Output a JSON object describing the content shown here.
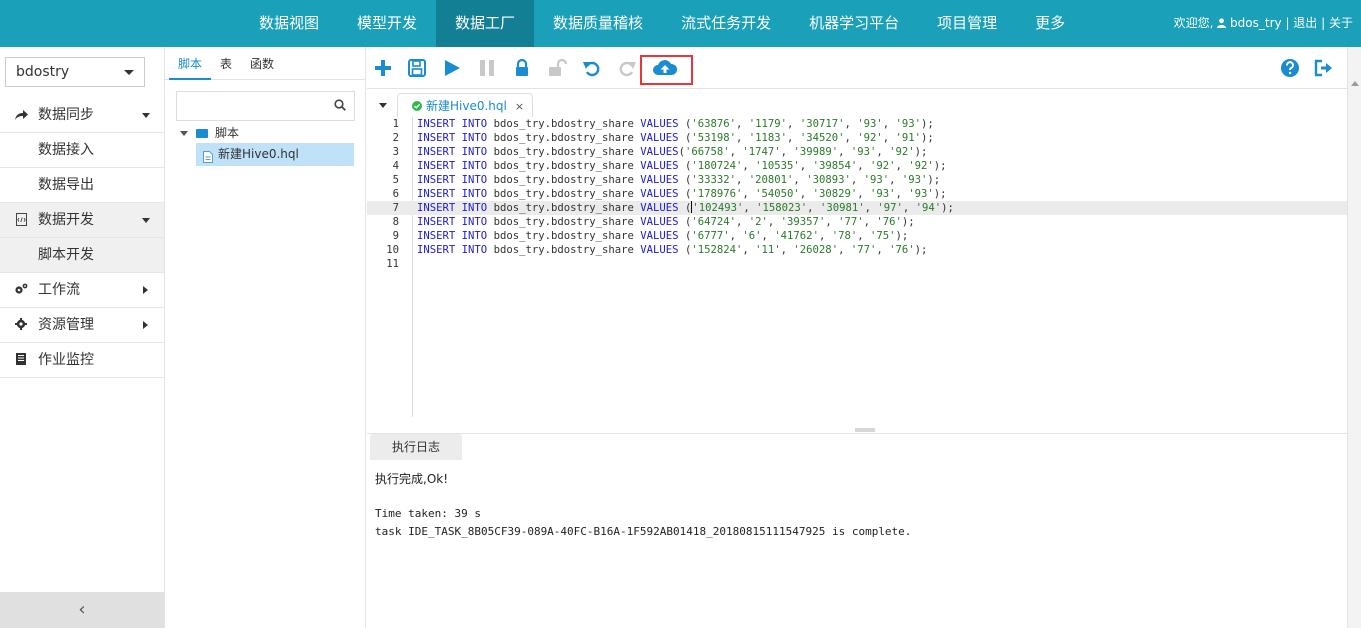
{
  "nav": {
    "items": [
      "数据视图",
      "模型开发",
      "数据工厂",
      "数据质量稽核",
      "流式任务开发",
      "机器学习平台",
      "项目管理",
      "更多"
    ],
    "active_index": 2
  },
  "user_bar": {
    "welcome": "欢迎您,",
    "username": "bdos_try",
    "sep1": " | ",
    "logout": "退出",
    "sep2": " | ",
    "about": "关于"
  },
  "sidebar": {
    "project": "bdostry",
    "menu": [
      {
        "label": "数据同步",
        "icon": "share-arrow-icon"
      },
      {
        "label": "数据接入"
      },
      {
        "label": "数据导出"
      },
      {
        "label": "数据开发",
        "icon": "code-file-icon"
      },
      {
        "label": "脚本开发"
      },
      {
        "label": "工作流",
        "icon": "cogs-icon"
      },
      {
        "label": "资源管理",
        "icon": "gear-icon"
      },
      {
        "label": "作业监控",
        "icon": "book-icon"
      }
    ],
    "collapse": "‹"
  },
  "script_panel": {
    "tabs": [
      "脚本",
      "表",
      "函数"
    ],
    "active_tab": 0,
    "search_placeholder": "",
    "folder": "脚本",
    "file": "新建Hive0.hql"
  },
  "editor": {
    "tab_label": "新建Hive0.hql",
    "tab_close": "×",
    "current_line": 7,
    "lines": [
      {
        "n": "1",
        "vals": [
          "'63876'",
          "'1179'",
          "'30717'",
          "'93'",
          "'93'"
        ],
        "space": true
      },
      {
        "n": "2",
        "vals": [
          "'53198'",
          "'1183'",
          "'34520'",
          "'92'",
          "'91'"
        ],
        "space": true
      },
      {
        "n": "3",
        "vals": [
          "'66758'",
          "'1747'",
          "'39989'",
          "'93'",
          "'92'"
        ],
        "space": false
      },
      {
        "n": "4",
        "vals": [
          "'180724'",
          "'10535'",
          "'39854'",
          "'92'",
          "'92'"
        ],
        "space": true
      },
      {
        "n": "5",
        "vals": [
          "'33332'",
          "'20801'",
          "'30893'",
          "'93'",
          "'93'"
        ],
        "space": true
      },
      {
        "n": "6",
        "vals": [
          "'178976'",
          "'54050'",
          "'30829'",
          "'93'",
          "'93'"
        ],
        "space": true
      },
      {
        "n": "7",
        "vals": [
          "'102493'",
          "'158023'",
          "'30981'",
          "'97'",
          "'94'"
        ],
        "space": true
      },
      {
        "n": "8",
        "vals": [
          "'64724'",
          "'2'",
          "'39357'",
          "'77'",
          "'76'"
        ],
        "space": true
      },
      {
        "n": "9",
        "vals": [
          "'6777'",
          "'6'",
          "'41762'",
          "'78'",
          "'75'"
        ],
        "space": true
      },
      {
        "n": "10",
        "vals": [
          "'152824'",
          "'11'",
          "'26028'",
          "'77'",
          "'76'"
        ],
        "space": true
      },
      {
        "n": "11",
        "vals": null
      }
    ],
    "kw_insert": "INSERT",
    "kw_into": "INTO",
    "kw_values": "VALUES",
    "table": "bdos_try.bdostry_share"
  },
  "log": {
    "tab": "执行日志",
    "line1": "执行完成,Ok!",
    "line2": "Time taken: 39 s",
    "line3": "task IDE_TASK_8B05CF39-089A-40FC-B16A-1F592AB01418_20180815111547925 is complete."
  },
  "colors": {
    "nav_bg": "#1ba0b9",
    "nav_active": "#137f95",
    "accent": "#1a8ccf",
    "highlight": "#e8363a"
  }
}
